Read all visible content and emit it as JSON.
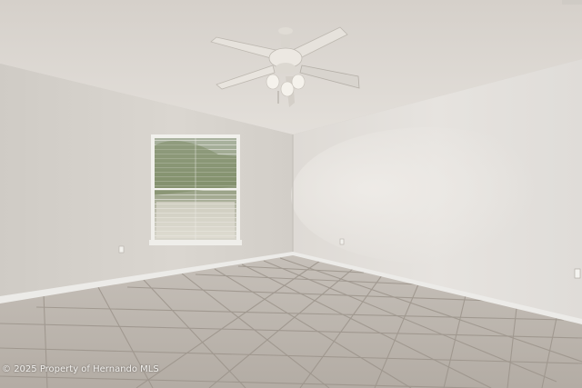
{
  "photo": {
    "subject": "empty room",
    "watermark": "2025 Property of Hernando MLS",
    "colors": {
      "ceiling": "#dcd7d1",
      "wall_left": "#d6d2cc",
      "wall_right": "#e2dfdb",
      "floor_tile": "#b9b2aa",
      "grout": "#8f877f",
      "window_glass": "#9aa58a",
      "fan_blade": "#e4e0da"
    }
  }
}
